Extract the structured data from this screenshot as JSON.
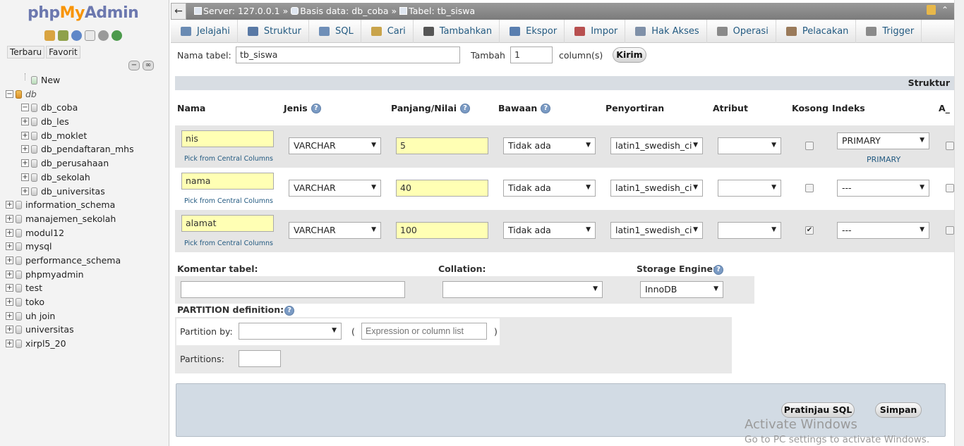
{
  "nav": {
    "logo": {
      "php": "php",
      "my": "My",
      "admin": "Admin"
    },
    "tabs": [
      "Terbaru",
      "Favorit"
    ],
    "tree": [
      {
        "label": "New",
        "level": 1,
        "exp": "",
        "italic": false
      },
      {
        "label": "db",
        "level": 0,
        "exp": "−",
        "italic": true
      },
      {
        "label": "db_coba",
        "level": 1,
        "exp": "−",
        "italic": false
      },
      {
        "label": "db_les",
        "level": 1,
        "exp": "+",
        "italic": false
      },
      {
        "label": "db_moklet",
        "level": 1,
        "exp": "+",
        "italic": false
      },
      {
        "label": "db_pendaftaran_mhs",
        "level": 1,
        "exp": "+",
        "italic": false
      },
      {
        "label": "db_perusahaan",
        "level": 1,
        "exp": "+",
        "italic": false
      },
      {
        "label": "db_sekolah",
        "level": 1,
        "exp": "+",
        "italic": false
      },
      {
        "label": "db_universitas",
        "level": 1,
        "exp": "+",
        "italic": false
      },
      {
        "label": "information_schema",
        "level": 0,
        "exp": "+",
        "italic": false
      },
      {
        "label": "manajemen_sekolah",
        "level": 0,
        "exp": "+",
        "italic": false
      },
      {
        "label": "modul12",
        "level": 0,
        "exp": "+",
        "italic": false
      },
      {
        "label": "mysql",
        "level": 0,
        "exp": "+",
        "italic": false
      },
      {
        "label": "performance_schema",
        "level": 0,
        "exp": "+",
        "italic": false
      },
      {
        "label": "phpmyadmin",
        "level": 0,
        "exp": "+",
        "italic": false
      },
      {
        "label": "test",
        "level": 0,
        "exp": "+",
        "italic": false
      },
      {
        "label": "toko",
        "level": 0,
        "exp": "+",
        "italic": false
      },
      {
        "label": "uh join",
        "level": 0,
        "exp": "+",
        "italic": false
      },
      {
        "label": "universitas",
        "level": 0,
        "exp": "+",
        "italic": false
      },
      {
        "label": "xirpl5_20",
        "level": 0,
        "exp": "+",
        "italic": false
      }
    ]
  },
  "topbar": {
    "back": "←",
    "server": "Server: 127.0.0.1",
    "sep": "»",
    "database": "Basis data: db_coba",
    "table": "Tabel: tb_siswa"
  },
  "tabs": [
    {
      "label": "Jelajahi",
      "icon": "browse-icon",
      "color": "#6a8bb3"
    },
    {
      "label": "Struktur",
      "icon": "structure-icon",
      "color": "#5979a5"
    },
    {
      "label": "SQL",
      "icon": "sql-icon",
      "color": "#6f8fb8"
    },
    {
      "label": "Cari",
      "icon": "search-icon",
      "color": "#c9a44b"
    },
    {
      "label": "Tambahkan",
      "icon": "insert-icon",
      "color": "#555555"
    },
    {
      "label": "Ekspor",
      "icon": "export-icon",
      "color": "#5a7fb0"
    },
    {
      "label": "Impor",
      "icon": "import-icon",
      "color": "#b85050"
    },
    {
      "label": "Hak Akses",
      "icon": "privileges-icon",
      "color": "#7f90a8"
    },
    {
      "label": "Operasi",
      "icon": "operations-icon",
      "color": "#8a8a8a"
    },
    {
      "label": "Pelacakan",
      "icon": "tracking-icon",
      "color": "#9a7a5a"
    },
    {
      "label": "Trigger",
      "icon": "trigger-icon",
      "color": "#8a8a8a"
    }
  ],
  "form": {
    "table_name_label": "Nama tabel:",
    "table_name_value": "tb_siswa",
    "add_label": "Tambah",
    "add_value": "1",
    "columns_label": "column(s)",
    "submit": "Kirim",
    "struktur_label": "Struktur",
    "headers": {
      "nama": "Nama",
      "jenis": "Jenis",
      "panjang": "Panjang/Nilai",
      "bawaan": "Bawaan",
      "penyortiran": "Penyortiran",
      "atribut": "Atribut",
      "kosong": "Kosong",
      "indeks": "Indeks",
      "ai": "A_I"
    },
    "pick_text": "Pick from Central Columns",
    "columns": [
      {
        "name": "nis",
        "type": "VARCHAR",
        "length": "5",
        "default": "Tidak ada",
        "collation": "latin1_swedish_ci",
        "attribute": "",
        "null_checked": false,
        "index": "PRIMARY",
        "index_note": "PRIMARY"
      },
      {
        "name": "nama",
        "type": "VARCHAR",
        "length": "40",
        "default": "Tidak ada",
        "collation": "latin1_swedish_ci",
        "attribute": "",
        "null_checked": false,
        "index": "---",
        "index_note": ""
      },
      {
        "name": "alamat",
        "type": "VARCHAR",
        "length": "100",
        "default": "Tidak ada",
        "collation": "latin1_swedish_ci",
        "attribute": "",
        "null_checked": true,
        "index": "---",
        "index_note": ""
      }
    ],
    "comment_label": "Komentar tabel:",
    "collation_label": "Collation:",
    "engine_label": "Storage Engine:",
    "engine_value": "InnoDB",
    "partition_label": "PARTITION definition:",
    "partition_by_label": "Partition by:",
    "partition_expr_placeholder": "Expression or column list",
    "paren_open": "(",
    "paren_close": ")",
    "partitions_label": "Partitions:",
    "preview_sql": "Pratinjau SQL",
    "save": "Simpan"
  },
  "watermark": {
    "title": "Activate Windows",
    "subtitle": "Go to PC settings to activate Windows."
  }
}
